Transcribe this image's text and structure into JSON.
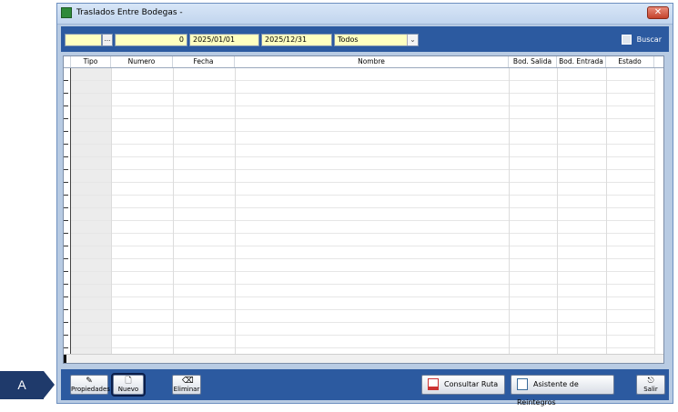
{
  "window": {
    "title": "Traslados Entre Bodegas -",
    "close_glyph": "✕"
  },
  "filters": {
    "code": "",
    "ellipsis": "...",
    "number": "0",
    "date_from": "2025/01/01",
    "date_to": "2025/12/31",
    "status": "Todos",
    "search_label": "Buscar"
  },
  "table": {
    "columns": [
      "Tipo",
      "Numero",
      "Fecha",
      "Nombre",
      "Bod. Salida",
      "Bod. Entrada",
      "Estado"
    ]
  },
  "buttons": {
    "propiedades": "Propiedades",
    "nuevo": "Nuevo",
    "eliminar": "Eliminar",
    "consultar_ruta": "Consultar Ruta",
    "asistente": "Asistente de Reintegros",
    "salir": "Salir"
  },
  "marker": {
    "label": "A"
  },
  "colors": {
    "toolbar": "#2c5aa0",
    "field": "#ffffc0",
    "marker": "#1f3a6b"
  }
}
